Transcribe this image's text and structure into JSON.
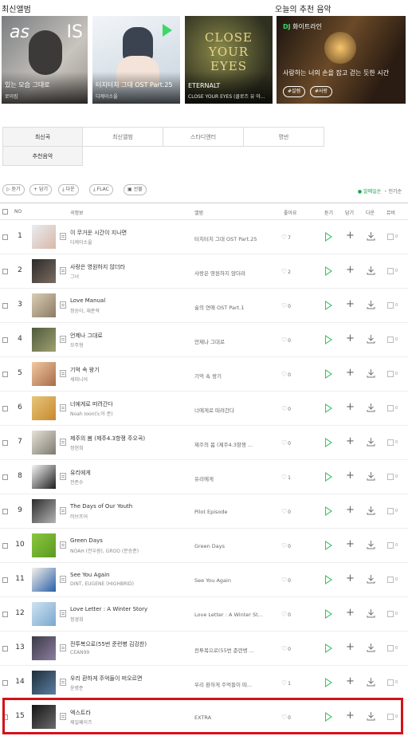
{
  "headers": {
    "latest_albums": "최신앨범",
    "recommend": "오늘의 추천 음악"
  },
  "albums": [
    {
      "title": "있는 모습 그대로",
      "artist": "로이킴",
      "colors": [
        "#6b6e72",
        "#c9c6c0"
      ]
    },
    {
      "title": "터치터치 그대 OST Part.25",
      "artist": "디케이소울",
      "colors": [
        "#eef2f5",
        "#b7c6d3"
      ]
    },
    {
      "title": "ETERNALT",
      "artist": "CLOSE YOUR EYES (클로즈 유 아이즈)",
      "colors": [
        "#3a3a2a",
        "#9a8a4a"
      ]
    }
  ],
  "album_text": {
    "as": "as",
    "is": "IS",
    "cover_text": "CLOSE YOUR EYES"
  },
  "recommend": {
    "tag_brand": "DJ",
    "tag_name": "화이트라인",
    "title": "사랑하는 너의 손을 잡고 걷는 듯한 시간",
    "chips": [
      "#설렘",
      "#사랑"
    ]
  },
  "tabs": [
    "최신곡",
    "최신앨범",
    "스타디엔터",
    "명반",
    "추천음악"
  ],
  "toolbar": {
    "play": "듣기",
    "add": "담기",
    "down": "다운",
    "flac": "FLAC",
    "gift": "선물",
    "opt_on": "발매일순",
    "opt_off": "인기순"
  },
  "columns": {
    "no": "NO",
    "song": "곡정보",
    "album": "앨범",
    "like": "좋아요",
    "listen": "듣기",
    "add": "담기",
    "down": "다운",
    "mv": "뮤비"
  },
  "rows": [
    {
      "rank": "1",
      "title": "이 무거운 시간이 지나면",
      "artist": "디케이소울",
      "album": "터치터치 그대 OST Part.25",
      "likes": "7",
      "thumb": [
        "#e9edf0",
        "#d8b7a8"
      ]
    },
    {
      "rank": "2",
      "title": "사랑은 영원하지 않더라",
      "artist": "그녀",
      "album": "사랑은 영원하지 않더라",
      "likes": "2",
      "thumb": [
        "#2c2a2a",
        "#7b6d62"
      ]
    },
    {
      "rank": "3",
      "title": "Love Manual",
      "artist": "정승아, 재준혁",
      "album": "술의 연애 OST Part.1",
      "likes": "0",
      "thumb": [
        "#d9cdb6",
        "#8c7a63"
      ]
    },
    {
      "rank": "4",
      "title": "언제나 그대로",
      "artist": "모주형",
      "album": "언제나 그대로",
      "likes": "0",
      "thumb": [
        "#4e5a3c",
        "#a1a071"
      ]
    },
    {
      "rank": "5",
      "title": "기억 속 왕기",
      "artist": "세피니어",
      "album": "기억 속 왕기",
      "likes": "0",
      "thumb": [
        "#f1c9a0",
        "#a86b4b"
      ]
    },
    {
      "rank": "6",
      "title": "너에게로 떠려간다",
      "artist": "Noah Ioon(노아 준)",
      "album": "너에게로 떠려간다",
      "likes": "0",
      "thumb": [
        "#e7c57a",
        "#c7892e"
      ]
    },
    {
      "rank": "7",
      "title": "제주의 봄 (제주4.3항쟁 주오곡)",
      "artist": "정현희",
      "album": "제주의 봄 (제주4.3항쟁 ...",
      "likes": "0",
      "thumb": [
        "#e6e2d8",
        "#7d7a70"
      ]
    },
    {
      "rank": "8",
      "title": "유리에게",
      "artist": "전준수",
      "album": "유리에게",
      "likes": "1",
      "thumb": [
        "#f5f5f5",
        "#1d1d1d"
      ]
    },
    {
      "rank": "9",
      "title": "The Days of Our Youth",
      "artist": "러브프어",
      "album": "Pilot Episode",
      "likes": "0",
      "thumb": [
        "#2b2b2b",
        "#b5b5b5"
      ]
    },
    {
      "rank": "10",
      "title": "Green Days",
      "artist": "NOAH (전우원), GROO (문승준)",
      "album": "Green Days",
      "likes": "0",
      "thumb": [
        "#8dc63f",
        "#5a9a22"
      ]
    },
    {
      "rank": "11",
      "title": "See You Again",
      "artist": "DINT, EUGENE (HIGHBRID)",
      "album": "See You Again",
      "likes": "0",
      "thumb": [
        "#f4f1e8",
        "#2a5fa8"
      ]
    },
    {
      "rank": "12",
      "title": "Love Letter : A Winter Story",
      "artist": "정경희",
      "album": "Love Letter : A Winter St...",
      "likes": "0",
      "thumb": [
        "#cfe3f2",
        "#7aa7cf"
      ]
    },
    {
      "rank": "13",
      "title": "전투복으로(55번 준련병 김강찬)",
      "artist": "CEAN99",
      "album": "전투복으로(55번 준련병 ...",
      "likes": "0",
      "thumb": [
        "#3b3a46",
        "#8d7fa0"
      ]
    },
    {
      "rank": "14",
      "title": "우리 환하게 주억들이 떠오르면",
      "artist": "윤병준",
      "album": "우리 환하게 주억들이 떠...",
      "likes": "1",
      "thumb": [
        "#1f2d3a",
        "#5c7fa1"
      ]
    },
    {
      "rank": "15",
      "title": "엑스트라",
      "artist": "제일페이즈",
      "album": "EXTRA",
      "likes": "0",
      "thumb": [
        "#141414",
        "#6c6c6c"
      ]
    }
  ],
  "mv_count": "0",
  "colors": {
    "accent": "#3ac463",
    "highlight": "#d3121a"
  }
}
